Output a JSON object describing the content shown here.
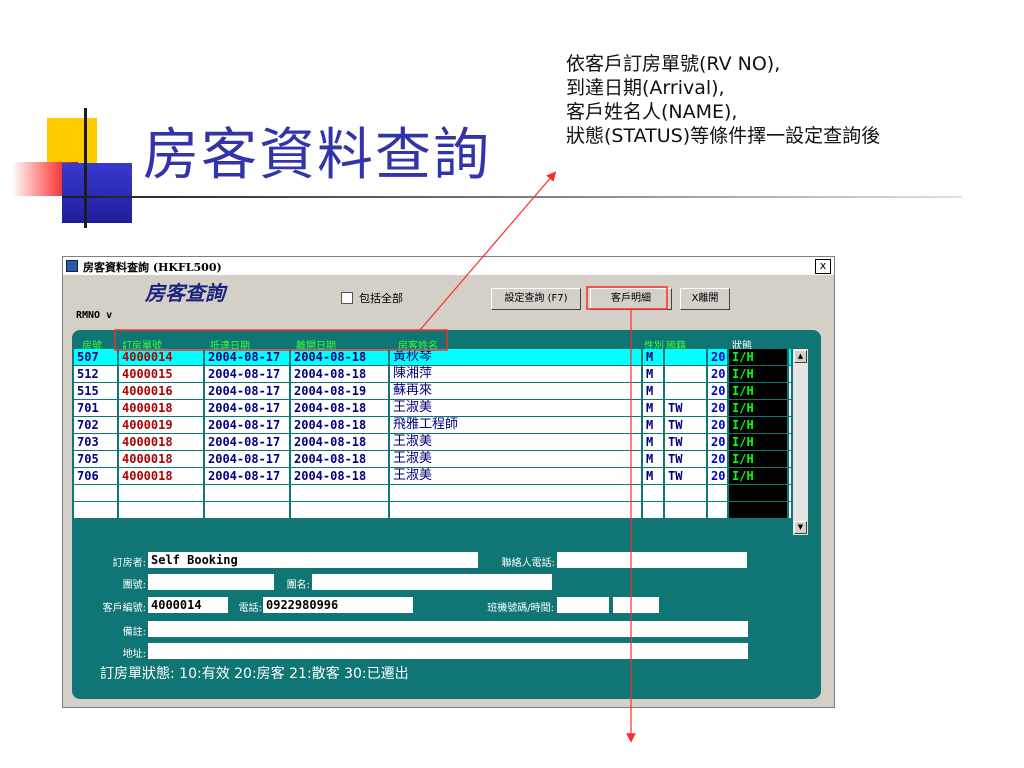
{
  "slide": {
    "title": "房客資料查詢",
    "annotation_lines": [
      "依客戶訂房單號(RV NO),",
      "到達日期(Arrival),",
      "客戶姓名人(NAME),",
      "狀態(STATUS)等條件擇一設定查詢後"
    ]
  },
  "window": {
    "title": "房客資料查詢 (HKFL500)",
    "close_label": "x",
    "form_title": "房客查詢",
    "rmno_label": "RMNO v",
    "include_all_label": "包括全部",
    "buttons": {
      "set_query": "設定查詢 (F7)",
      "customer_detail": "客戶明細",
      "leave": "X離開"
    }
  },
  "table": {
    "headers": {
      "room": "房號",
      "rv_no": "訂房單號",
      "arrival": "抵達日期",
      "departure": "離開日期",
      "guest_name": "房客姓名",
      "gender": "性別",
      "nationality": "國籍",
      "status": "狀態"
    },
    "rows": [
      {
        "room": "507",
        "rv": "4000014",
        "arr": "2004-08-17",
        "dep": "2004-08-18",
        "name": "黃秋琴",
        "sex": "M",
        "nat": "",
        "st": "20",
        "stt": "I/H"
      },
      {
        "room": "512",
        "rv": "4000015",
        "arr": "2004-08-17",
        "dep": "2004-08-18",
        "name": "陳湘萍",
        "sex": "M",
        "nat": "",
        "st": "20",
        "stt": "I/H"
      },
      {
        "room": "515",
        "rv": "4000016",
        "arr": "2004-08-17",
        "dep": "2004-08-19",
        "name": "蘇再來",
        "sex": "M",
        "nat": "",
        "st": "20",
        "stt": "I/H"
      },
      {
        "room": "701",
        "rv": "4000018",
        "arr": "2004-08-17",
        "dep": "2004-08-18",
        "name": "王淑美",
        "sex": "M",
        "nat": "TW",
        "st": "20",
        "stt": "I/H"
      },
      {
        "room": "702",
        "rv": "4000019",
        "arr": "2004-08-17",
        "dep": "2004-08-18",
        "name": "飛雅工程師",
        "sex": "M",
        "nat": "TW",
        "st": "20",
        "stt": "I/H"
      },
      {
        "room": "703",
        "rv": "4000018",
        "arr": "2004-08-17",
        "dep": "2004-08-18",
        "name": "王淑美",
        "sex": "M",
        "nat": "TW",
        "st": "20",
        "stt": "I/H"
      },
      {
        "room": "705",
        "rv": "4000018",
        "arr": "2004-08-17",
        "dep": "2004-08-18",
        "name": "王淑美",
        "sex": "M",
        "nat": "TW",
        "st": "20",
        "stt": "I/H"
      },
      {
        "room": "706",
        "rv": "4000018",
        "arr": "2004-08-17",
        "dep": "2004-08-18",
        "name": "王淑美",
        "sex": "M",
        "nat": "TW",
        "st": "20",
        "stt": "I/H"
      }
    ]
  },
  "details": {
    "booker_label": "訂房者:",
    "booker_value": "Self Booking",
    "contact_phone_label": "聯絡人電話:",
    "contact_phone_value": "",
    "group_no_label": "團號:",
    "group_no_value": "",
    "group_name_label": "團名:",
    "group_name_value": "",
    "customer_no_label": "客戶編號:",
    "customer_no_value": "4000014",
    "phone_label": "電話:",
    "phone_value": "0922980996",
    "flight_label": "班機號碼/時間:",
    "flight_no_value": "",
    "flight_time_value": "",
    "remark_label": "備註:",
    "remark_value": "",
    "address_label": "地址:",
    "address_value": ""
  },
  "status_legend": "訂房單狀態: 10:有效 20:房客 21:散客 30:已遷出",
  "colors": {
    "title": "#3333aa",
    "panel": "#0f7575",
    "header_text": "#33ff33",
    "selected_row": "#00ffff",
    "annotation_line": "#ff2a2a"
  }
}
